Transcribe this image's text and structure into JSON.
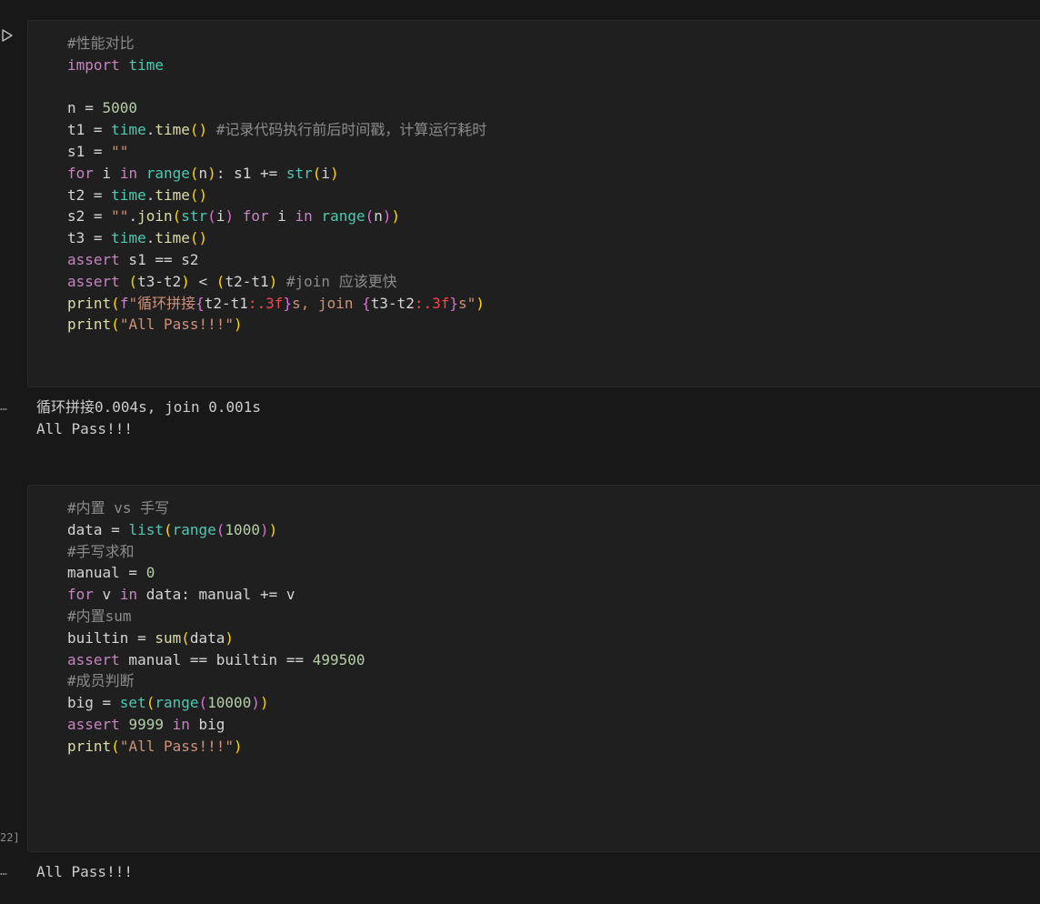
{
  "cells": [
    {
      "lines": [
        [
          [
            "cmg",
            "#性能对比"
          ]
        ],
        [
          [
            "kw",
            "import"
          ],
          [
            "plain",
            " "
          ],
          [
            "bi",
            "time"
          ]
        ],
        [],
        [
          [
            "plain",
            "n = "
          ],
          [
            "num",
            "5000"
          ]
        ],
        [
          [
            "plain",
            "t1 = "
          ],
          [
            "bi",
            "time"
          ],
          [
            "plain",
            "."
          ],
          [
            "fn",
            "time"
          ],
          [
            "p1",
            "()"
          ],
          [
            "plain",
            " "
          ],
          [
            "cmg",
            "#记录代码执行前后时间戳，计算运行耗时"
          ]
        ],
        [
          [
            "plain",
            "s1 = "
          ],
          [
            "str",
            "\"\""
          ]
        ],
        [
          [
            "kw",
            "for"
          ],
          [
            "plain",
            " i "
          ],
          [
            "kw",
            "in"
          ],
          [
            "plain",
            " "
          ],
          [
            "bi",
            "range"
          ],
          [
            "p1",
            "("
          ],
          [
            "plain",
            "n"
          ],
          [
            "p1",
            ")"
          ],
          [
            "plain",
            ": s1 += "
          ],
          [
            "bi",
            "str"
          ],
          [
            "p1",
            "("
          ],
          [
            "plain",
            "i"
          ],
          [
            "p1",
            ")"
          ]
        ],
        [
          [
            "plain",
            "t2 = "
          ],
          [
            "bi",
            "time"
          ],
          [
            "plain",
            "."
          ],
          [
            "fn",
            "time"
          ],
          [
            "p1",
            "()"
          ]
        ],
        [
          [
            "plain",
            "s2 = "
          ],
          [
            "str",
            "\"\""
          ],
          [
            "plain",
            "."
          ],
          [
            "fn",
            "join"
          ],
          [
            "p1",
            "("
          ],
          [
            "bi",
            "str"
          ],
          [
            "p2",
            "("
          ],
          [
            "plain",
            "i"
          ],
          [
            "p2",
            ")"
          ],
          [
            "plain",
            " "
          ],
          [
            "kw",
            "for"
          ],
          [
            "plain",
            " i "
          ],
          [
            "kw",
            "in"
          ],
          [
            "plain",
            " "
          ],
          [
            "bi",
            "range"
          ],
          [
            "p2",
            "("
          ],
          [
            "plain",
            "n"
          ],
          [
            "p2",
            ")"
          ],
          [
            "p1",
            ")"
          ]
        ],
        [
          [
            "plain",
            "t3 = "
          ],
          [
            "bi",
            "time"
          ],
          [
            "plain",
            "."
          ],
          [
            "fn",
            "time"
          ],
          [
            "p1",
            "()"
          ]
        ],
        [
          [
            "kw",
            "assert"
          ],
          [
            "plain",
            " s1 == s2"
          ]
        ],
        [
          [
            "kw",
            "assert"
          ],
          [
            "plain",
            " "
          ],
          [
            "p1",
            "("
          ],
          [
            "plain",
            "t3-t2"
          ],
          [
            "p1",
            ")"
          ],
          [
            "plain",
            " < "
          ],
          [
            "p1",
            "("
          ],
          [
            "plain",
            "t2-t1"
          ],
          [
            "p1",
            ")"
          ],
          [
            "plain",
            " "
          ],
          [
            "cmg",
            "#join 应该更快"
          ]
        ],
        [
          [
            "fn",
            "print"
          ],
          [
            "p1",
            "("
          ],
          [
            "kw",
            "f"
          ],
          [
            "str",
            "\"循环拼接"
          ],
          [
            "p2",
            "{"
          ],
          [
            "plain",
            "t2-t1"
          ],
          [
            "fmt",
            ":.3f"
          ],
          [
            "p2",
            "}"
          ],
          [
            "str",
            "s, join "
          ],
          [
            "p2",
            "{"
          ],
          [
            "plain",
            "t3-t2"
          ],
          [
            "fmt",
            ":.3f"
          ],
          [
            "p2",
            "}"
          ],
          [
            "str",
            "s\""
          ],
          [
            "p1",
            ")"
          ]
        ],
        [
          [
            "fn",
            "print"
          ],
          [
            "p1",
            "("
          ],
          [
            "str",
            "\"All Pass!!!\""
          ],
          [
            "p1",
            ")"
          ]
        ]
      ],
      "output": [
        "循环拼接0.004s, join 0.001s",
        "All Pass!!!"
      ]
    },
    {
      "lines": [
        [
          [
            "cmg",
            "#内置 vs 手写"
          ]
        ],
        [
          [
            "plain",
            "data = "
          ],
          [
            "bi",
            "list"
          ],
          [
            "p1",
            "("
          ],
          [
            "bi",
            "range"
          ],
          [
            "p2",
            "("
          ],
          [
            "num",
            "1000"
          ],
          [
            "p2",
            ")"
          ],
          [
            "p1",
            ")"
          ]
        ],
        [
          [
            "cmg",
            "#手写求和"
          ]
        ],
        [
          [
            "plain",
            "manual = "
          ],
          [
            "num",
            "0"
          ]
        ],
        [
          [
            "kw",
            "for"
          ],
          [
            "plain",
            " v "
          ],
          [
            "kw",
            "in"
          ],
          [
            "plain",
            " data: manual += v"
          ]
        ],
        [
          [
            "cmg",
            "#内置sum"
          ]
        ],
        [
          [
            "plain",
            "builtin = "
          ],
          [
            "fn",
            "sum"
          ],
          [
            "p1",
            "("
          ],
          [
            "plain",
            "data"
          ],
          [
            "p1",
            ")"
          ]
        ],
        [
          [
            "kw",
            "assert"
          ],
          [
            "plain",
            " manual == builtin == "
          ],
          [
            "num",
            "499500"
          ]
        ],
        [
          [
            "cmg",
            "#成员判断"
          ]
        ],
        [
          [
            "plain",
            "big = "
          ],
          [
            "bi",
            "set"
          ],
          [
            "p1",
            "("
          ],
          [
            "bi",
            "range"
          ],
          [
            "p2",
            "("
          ],
          [
            "num",
            "10000"
          ],
          [
            "p2",
            ")"
          ],
          [
            "p1",
            ")"
          ]
        ],
        [
          [
            "kw",
            "assert"
          ],
          [
            "plain",
            " "
          ],
          [
            "num",
            "9999"
          ],
          [
            "plain",
            " "
          ],
          [
            "kw",
            "in"
          ],
          [
            "plain",
            " big"
          ]
        ],
        [
          [
            "fn",
            "print"
          ],
          [
            "p1",
            "("
          ],
          [
            "str",
            "\"All Pass!!!\""
          ],
          [
            "p1",
            ")"
          ]
        ]
      ],
      "exec_count": "22]",
      "output": [
        "All Pass!!!"
      ]
    }
  ],
  "output_menu_glyph": "…",
  "icons": {
    "run": "run-icon"
  }
}
